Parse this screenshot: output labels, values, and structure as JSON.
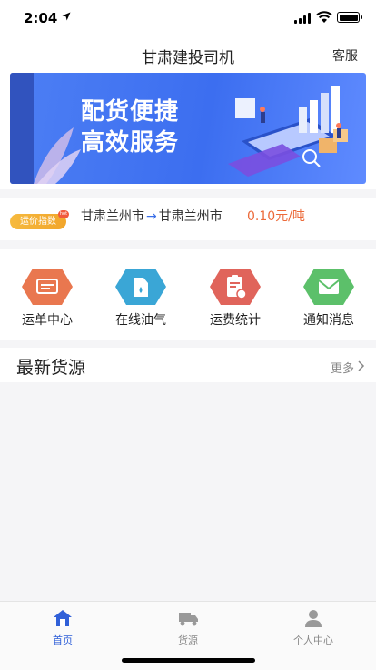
{
  "status_bar": {
    "time": "2:04"
  },
  "nav": {
    "title": "甘肃建投司机",
    "service_label": "客服"
  },
  "banner": {
    "line1": "配货便捷",
    "line2": "高效服务"
  },
  "price_index": {
    "tag": "运价指数",
    "badge": "hot",
    "from": "甘肃兰州市",
    "to": "甘肃兰州市",
    "price": "0.10元/吨"
  },
  "quick_actions": [
    {
      "label": "运单中心",
      "icon": "waybill-icon",
      "color": "#e9774f"
    },
    {
      "label": "在线油气",
      "icon": "fuel-icon",
      "color": "#3aa6d6"
    },
    {
      "label": "运费统计",
      "icon": "freight-stats-icon",
      "color": "#e0645b"
    },
    {
      "label": "通知消息",
      "icon": "message-icon",
      "color": "#5cc06a"
    }
  ],
  "latest_goods": {
    "title": "最新货源",
    "more_label": "更多"
  },
  "tabs": [
    {
      "label": "首页",
      "icon": "home-icon",
      "active": true
    },
    {
      "label": "货源",
      "icon": "truck-icon",
      "active": false
    },
    {
      "label": "个人中心",
      "icon": "person-icon",
      "active": false
    }
  ]
}
